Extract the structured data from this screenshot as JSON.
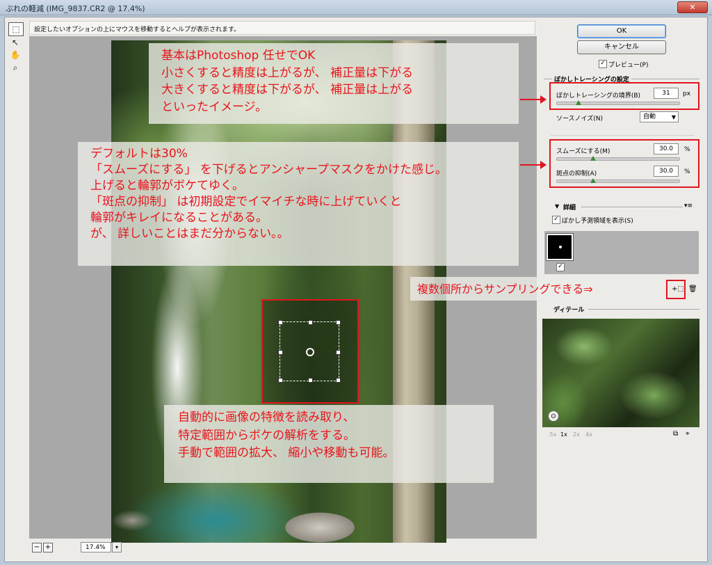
{
  "window": {
    "title": "ぶれの軽減 (IMG_9837.CR2 @ 17.4%)"
  },
  "help_text": "設定したいオプションの上にマウスを移動するとヘルプが表示されます。",
  "toolbar": {
    "tools": [
      "marquee-tool",
      "arrow-tool",
      "hand-tool",
      "zoom-tool"
    ]
  },
  "buttons": {
    "ok": "OK",
    "cancel": "キャンセル"
  },
  "preview": {
    "label": "プレビュー(P)",
    "checked": true
  },
  "blur_trace": {
    "header": "ぼかしトレーシングの設定",
    "bounds_label": "ぼかしトレーシングの境界(B)",
    "bounds_value": "31",
    "bounds_unit": "px",
    "bounds_slider": 0.18,
    "source_noise_label": "ソースノイズ(N)",
    "source_noise_value": "自動",
    "smoothing_label": "スムーズにする(M)",
    "smoothing_value": "30.0",
    "smoothing_unit": "%",
    "smoothing_slider": 0.3,
    "artifact_label": "斑点の抑制(A)",
    "artifact_value": "30.0",
    "artifact_unit": "%",
    "artifact_slider": 0.3
  },
  "advanced": {
    "header": "詳細",
    "show_estimation_label": "ぼかし予測領域を表示(S)",
    "show_estimation_checked": true,
    "sample_checked": true
  },
  "detail": {
    "header": "ディテール",
    "zoom_levels": [
      ".5x",
      "1x",
      "2x",
      "4x"
    ],
    "active_zoom": "1x"
  },
  "zoom": {
    "value": "17.4%",
    "minus": "−",
    "plus": "+"
  },
  "notes": {
    "note1": [
      "基本はPhotoshop 任せでOK",
      "小さくすると精度は上がるが、 補正量は下がる",
      "大きくすると精度は下がるが、 補正量は上がる",
      "といったイメージ。"
    ],
    "note2": [
      "デフォルトは30%",
      "「スムーズにする」 を下げるとアンシャープマスクをかけた感じ。",
      "上げると輪郭がボケてゆく。",
      "「斑点の抑制」 は初期設定でイマイチな時に上げていくと",
      "輪郭がキレイになることがある。",
      "が、 詳しいことはまだ分からない。。"
    ],
    "note3": [
      "自動的に画像の特徴を読み取り、",
      "特定範囲からボケの解析をする。",
      "手動で範囲の拡大、 縮小や移動も可能。"
    ],
    "note4": "複数個所からサンプリングできる⇒"
  },
  "colors": {
    "annotation": "#e0141c",
    "ok_border": "#3a7fd0",
    "slider_knob": "#3a8a3a"
  }
}
